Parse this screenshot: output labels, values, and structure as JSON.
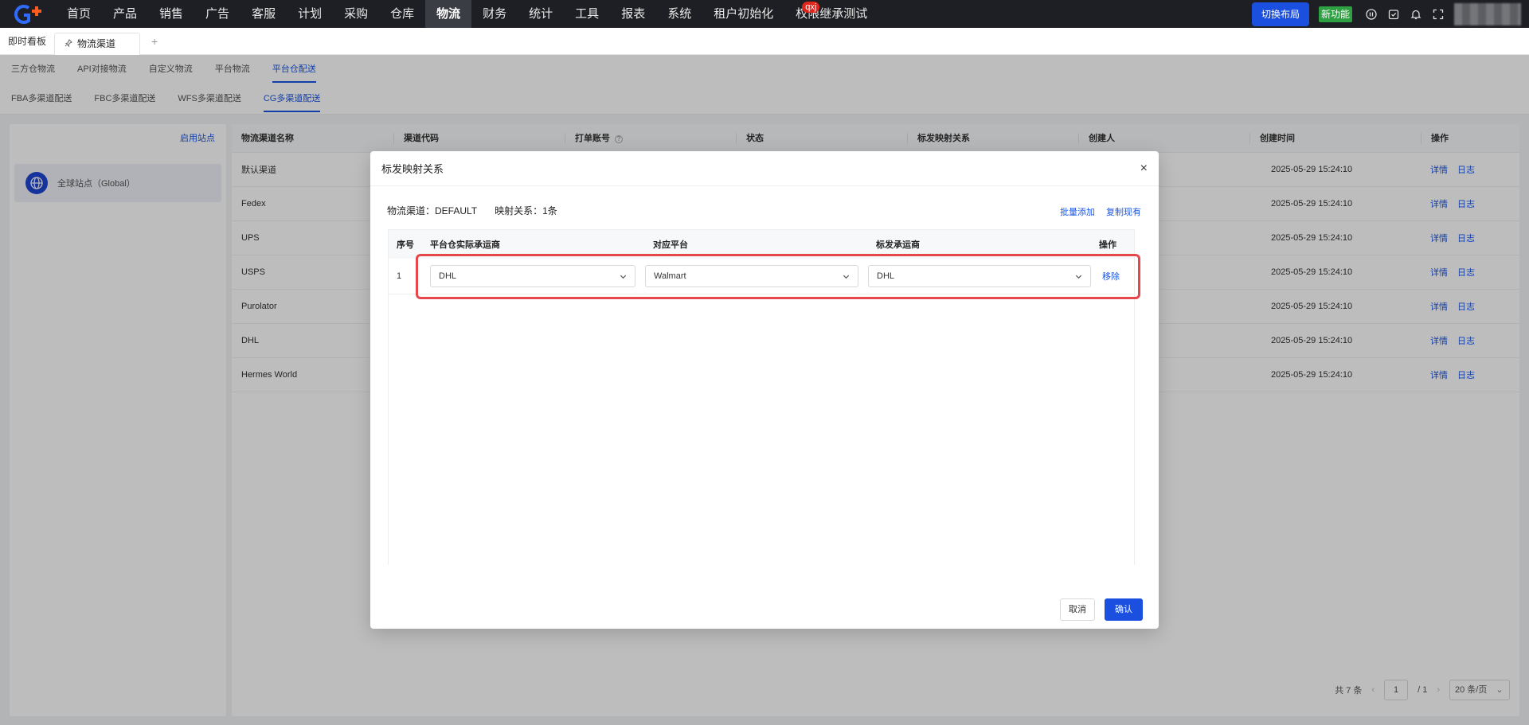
{
  "nav": {
    "items": [
      {
        "label": "首页"
      },
      {
        "label": "产品"
      },
      {
        "label": "销售"
      },
      {
        "label": "广告"
      },
      {
        "label": "客服"
      },
      {
        "label": "计划"
      },
      {
        "label": "采购"
      },
      {
        "label": "仓库"
      },
      {
        "label": "物流"
      },
      {
        "label": "财务"
      },
      {
        "label": "统计"
      },
      {
        "label": "工具"
      },
      {
        "label": "报表"
      },
      {
        "label": "系统"
      },
      {
        "label": "租户初始化"
      },
      {
        "label": "权限继承测试"
      }
    ],
    "active_index": 8,
    "badge": "qxj",
    "switch_layout": "切换布局",
    "new_feature": "新功能"
  },
  "tabs": {
    "home": "即时看板",
    "active": "物流渠道",
    "add": "+"
  },
  "subtabs1": [
    "三方仓物流",
    "API对接物流",
    "自定义物流",
    "平台物流",
    "平台仓配送"
  ],
  "subtabs1_active": 4,
  "subtabs2": [
    "FBA多渠道配送",
    "FBC多渠道配送",
    "WFS多渠道配送",
    "CG多渠道配送"
  ],
  "subtabs2_active": 3,
  "sidebar": {
    "enable_site": "启用站点",
    "site": "全球站点（Global）"
  },
  "table": {
    "headers": [
      "物流渠道名称",
      "渠道代码",
      "打单账号",
      "状态",
      "标发映射关系",
      "创建人",
      "创建时间",
      "操作"
    ],
    "rows": [
      {
        "name": "默认渠道",
        "time": "2025-05-29 15:24:10"
      },
      {
        "name": "Fedex",
        "time": "2025-05-29 15:24:10"
      },
      {
        "name": "UPS",
        "time": "2025-05-29 15:24:10"
      },
      {
        "name": "USPS",
        "time": "2025-05-29 15:24:10"
      },
      {
        "name": "Purolator",
        "time": "2025-05-29 15:24:10"
      },
      {
        "name": "DHL",
        "time": "2025-05-29 15:24:10"
      },
      {
        "name": "Hermes World",
        "time": "2025-05-29 15:24:10"
      }
    ],
    "action_detail": "详情",
    "action_log": "日志"
  },
  "pager": {
    "total": "共 7 条",
    "page": "1",
    "pages": "/  1",
    "size": "20 条/页"
  },
  "modal": {
    "title": "标发映射关系",
    "close": "×",
    "channel_label": "物流渠道：DEFAULT",
    "mapping_label": "映射关系：1条",
    "batch_add": "批量添加",
    "copy_existing": "复制现有",
    "headers": [
      "序号",
      "平台仓实际承运商",
      "对应平台",
      "标发承运商",
      "操作"
    ],
    "row": {
      "index": "1",
      "carrier": "DHL",
      "platform": "Walmart",
      "label_carrier": "DHL",
      "remove": "移除"
    },
    "cancel": "取消",
    "confirm": "确认"
  },
  "colors": {
    "accent": "#1a55e3",
    "highlight": "#e5474b",
    "nav_bg": "#1d1f24"
  }
}
